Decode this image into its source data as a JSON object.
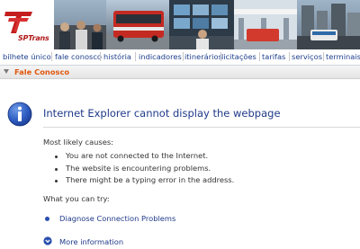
{
  "header": {
    "logo_text": "SPTrans",
    "brand_color": "#c41e1e"
  },
  "nav": {
    "items": [
      {
        "label": "bilhete único"
      },
      {
        "label": "fale conosco"
      },
      {
        "label": "história"
      },
      {
        "label": "indicadores"
      },
      {
        "label": "itinerários"
      },
      {
        "label": "licitações"
      },
      {
        "label": "tarifas"
      },
      {
        "label": "serviços"
      },
      {
        "label": "terminais"
      }
    ],
    "link_color": "#1d3f8c"
  },
  "section": {
    "title": "Fale Conosco",
    "title_color": "#e0560d"
  },
  "error_page": {
    "title": "Internet Explorer cannot display the webpage",
    "causes_heading": "Most likely causes:",
    "causes": [
      "You are not connected to the Internet.",
      "The website is encountering problems.",
      "There might be a typing error in the address."
    ],
    "try_heading": "What you can try:",
    "diagnose_link": "Diagnose Connection Problems",
    "more_info_link": "More information",
    "info_icon": "info-icon"
  }
}
